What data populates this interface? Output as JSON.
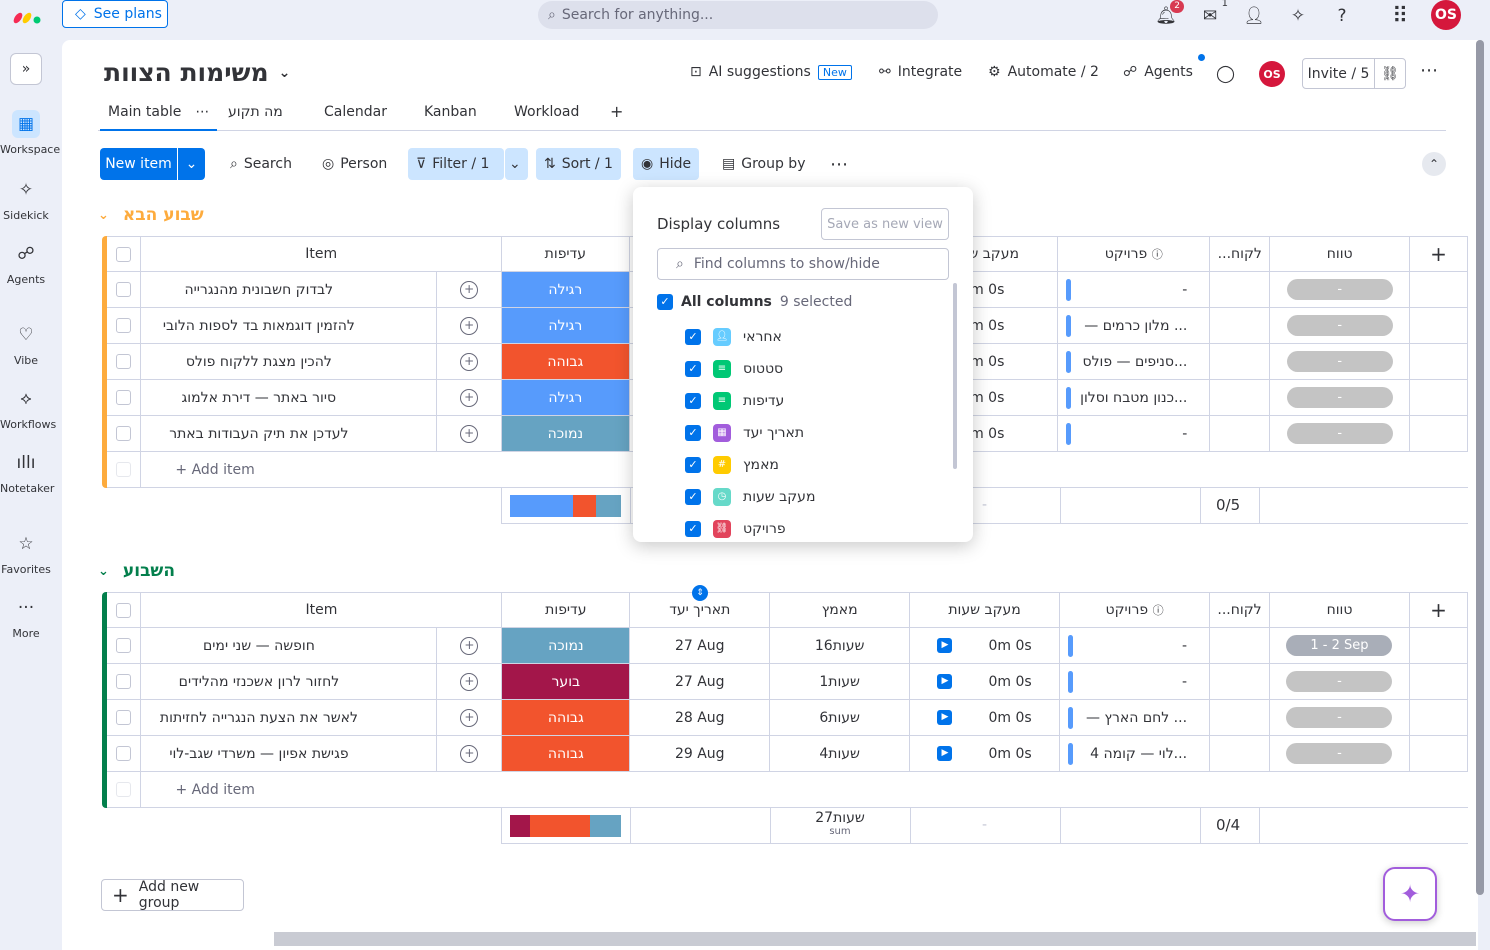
{
  "topbar": {
    "see_plans": "See plans",
    "search_placeholder": "Search for anything...",
    "notif_count": "2",
    "inbox_count": "1",
    "avatar": "OS"
  },
  "sidebar": {
    "items": [
      {
        "label": "Workspace",
        "icon": "grid-icon"
      },
      {
        "label": "Sidekick",
        "icon": "sparkle-icon"
      },
      {
        "label": "Agents",
        "icon": "agents-icon"
      },
      {
        "label": "Vibe",
        "icon": "heart-icon"
      },
      {
        "label": "Workflows",
        "icon": "workflow-icon"
      },
      {
        "label": "Notetaker",
        "icon": "waveform-icon"
      },
      {
        "label": "Favorites",
        "icon": "star-icon"
      },
      {
        "label": "More",
        "icon": "dots-icon"
      }
    ]
  },
  "board": {
    "title": "משימות הצוות",
    "ai_suggestions": "AI suggestions",
    "new_tag": "New",
    "integrate": "Integrate",
    "automate": "Automate / 2",
    "agents": "Agents",
    "avatar": "OS",
    "invite": "Invite / 5"
  },
  "tabs": [
    {
      "label": "Main table"
    },
    {
      "label": "מה תקוע"
    },
    {
      "label": "Calendar"
    },
    {
      "label": "Kanban"
    },
    {
      "label": "Workload"
    },
    {
      "label": "+"
    }
  ],
  "toolbar": {
    "new_item": "New item",
    "search": "Search",
    "person": "Person",
    "filter": "Filter / 1",
    "sort": "Sort / 1",
    "hide": "Hide",
    "group_by": "Group by"
  },
  "columns": {
    "item": "Item",
    "priority": "עדיפות",
    "date": "תאריך יעד",
    "effort": "מאמץ",
    "time": "מעקב שעות",
    "project": "פרויקט",
    "client": "...לקוח",
    "timeline": "טווח"
  },
  "groups": [
    {
      "title": "שבוע הבא",
      "color": "#fdab3d",
      "rows": [
        {
          "name": "לבדוק חשבונית מהנגרייה",
          "priority": "רגילה",
          "pcolor": "#579bfc",
          "time": "0m 0s",
          "project": "-",
          "timeline": "-"
        },
        {
          "name": "להזמין דוגמאות בד לספות הלובי",
          "priority": "רגילה",
          "pcolor": "#579bfc",
          "time": "0m 0s",
          "project": "... מלון כרמים —",
          "timeline": "-"
        },
        {
          "name": "להכין מצגת ללקוח פולס",
          "priority": "גבוהה",
          "pcolor": "#e2445c",
          "time": "0m 0s",
          "project": "...סניפים — פולס",
          "timeline": "-"
        },
        {
          "name": "סיור באתר — דירת אלמוג",
          "priority": "רגילה",
          "pcolor": "#579bfc",
          "time": "0m 0s",
          "project": "...כנון מטבח וסלון",
          "timeline": "-"
        },
        {
          "name": "לעדכן את תיק העבודות באתר",
          "priority": "נמוכה",
          "pcolor": "#66a3c2",
          "time": "0m 0s",
          "project": "-",
          "timeline": "-"
        }
      ],
      "add_item": "+ Add item",
      "summary_time": "-",
      "summary_client": "0/5"
    },
    {
      "title": "השבוע",
      "color": "#037f4c",
      "rows": [
        {
          "name": "חופשה — שני ימים",
          "priority": "נמוכה",
          "pcolor": "#66a3c2",
          "date": "27 Aug",
          "effort": "16שעות",
          "time": "0m 0s",
          "project": "-",
          "timeline": "1 - 2 Sep"
        },
        {
          "name": "לחזור לרון אשכנזי מהלידים",
          "priority": "בוער",
          "pcolor": "#a3164a",
          "date": "27 Aug",
          "effort": "1שעות",
          "time": "0m 0s",
          "project": "-",
          "timeline": "-"
        },
        {
          "name": "לאשר את הצעת הנגרייה לחזיתות",
          "priority": "גבוהה",
          "pcolor": "#f2542d",
          "date": "28 Aug",
          "effort": "6שעות",
          "time": "0m 0s",
          "project": "... לחם הארץ —",
          "timeline": "-"
        },
        {
          "name": "פגישת אפיון — משרדי שגב-לוי",
          "priority": "גבוהה",
          "pcolor": "#f2542d",
          "date": "29 Aug",
          "effort": "4שעות",
          "time": "0m 0s",
          "project": "...לוי — קומה 4",
          "timeline": "-"
        }
      ],
      "add_item": "+ Add item",
      "summary_effort": "27שעות",
      "summary_effort_sub": "sum",
      "summary_time": "-",
      "summary_client": "0/4"
    }
  ],
  "add_group": "Add new group",
  "popup": {
    "title": "Display columns",
    "save_view": "Save as new view",
    "find_placeholder": "Find columns to show/hide",
    "all_columns": "All columns",
    "selected": "9 selected",
    "items": [
      {
        "label": "אחראי",
        "color": "#66ccff"
      },
      {
        "label": "סטטוס",
        "color": "#00c875"
      },
      {
        "label": "עדיפות",
        "color": "#00c875"
      },
      {
        "label": "תאריך יעד",
        "color": "#a25ddc"
      },
      {
        "label": "מאמץ",
        "color": "#ffcb00"
      },
      {
        "label": "מעקב שעות",
        "color": "#66d9c9"
      },
      {
        "label": "פרויקט",
        "color": "#e2445c"
      }
    ]
  }
}
